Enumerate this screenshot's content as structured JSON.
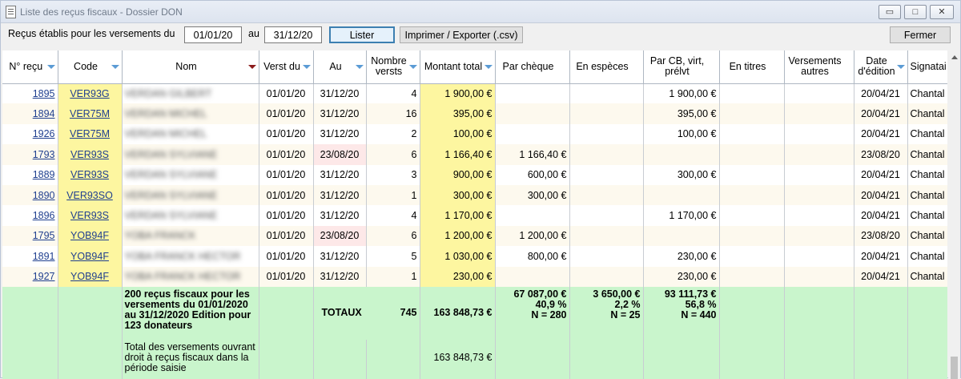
{
  "window": {
    "title": "Liste des reçus fiscaux - Dossier DON",
    "min_glyph": "▭",
    "max_glyph": "□",
    "close_glyph": "✕"
  },
  "toolbar": {
    "label_range": "Reçus établis pour les versements du",
    "date_from": "01/01/20",
    "label_to": "au",
    "date_to": "31/12/20",
    "lister": "Lister",
    "export": "Imprimer / Exporter (.csv)",
    "fermer": "Fermer"
  },
  "columns": {
    "num": "N° reçu",
    "code": "Code",
    "nom": "Nom",
    "verst_du": "Verst du",
    "au": "Au",
    "nb": "Nombre versts",
    "montant": "Montant total",
    "cheque": "Par chèque",
    "especes": "En espèces",
    "cb": "Par CB, virt, prélvt",
    "titres": "En titres",
    "autres": "Versements autres",
    "date_edition": "Date d'édition",
    "signataire": "Signatai"
  },
  "rows": [
    {
      "num": "1895",
      "code": "VER93G",
      "nom": "VERDAN GILBERT",
      "du": "01/01/20",
      "au": "31/12/20",
      "nb": "4",
      "montant": "1 900,00 €",
      "cheque": "",
      "especes": "",
      "cb": "1 900,00 €",
      "titres": "",
      "autres": "",
      "date": "20/04/21",
      "sig": "Chantal"
    },
    {
      "num": "1894",
      "code": "VER75M",
      "nom": "VERDAN MICHEL",
      "du": "01/01/20",
      "au": "31/12/20",
      "nb": "16",
      "montant": "395,00 €",
      "cheque": "",
      "especes": "",
      "cb": "395,00 €",
      "titres": "",
      "autres": "",
      "date": "20/04/21",
      "sig": "Chantal"
    },
    {
      "num": "1926",
      "code": "VER75M",
      "nom": "VERDAN MICHEL",
      "du": "01/01/20",
      "au": "31/12/20",
      "nb": "2",
      "montant": "100,00 €",
      "cheque": "",
      "especes": "",
      "cb": "100,00 €",
      "titres": "",
      "autres": "",
      "date": "20/04/21",
      "sig": "Chantal"
    },
    {
      "num": "1793",
      "code": "VER93S",
      "nom": "VERDAN SYLVIANE",
      "du": "01/01/20",
      "au": "23/08/20",
      "nb": "6",
      "montant": "1 166,40 €",
      "cheque": "1 166,40 €",
      "especes": "",
      "cb": "",
      "titres": "",
      "autres": "",
      "date": "23/08/20",
      "sig": "Chantal"
    },
    {
      "num": "1889",
      "code": "VER93S",
      "nom": "VERDAN SYLVIANE",
      "du": "01/01/20",
      "au": "31/12/20",
      "nb": "3",
      "montant": "900,00 €",
      "cheque": "600,00 €",
      "especes": "",
      "cb": "300,00 €",
      "titres": "",
      "autres": "",
      "date": "20/04/21",
      "sig": "Chantal"
    },
    {
      "num": "1890",
      "code": "VER93SO",
      "nom": "VERDAN SYLVIANE",
      "du": "01/01/20",
      "au": "31/12/20",
      "nb": "1",
      "montant": "300,00 €",
      "cheque": "300,00 €",
      "especes": "",
      "cb": "",
      "titres": "",
      "autres": "",
      "date": "20/04/21",
      "sig": "Chantal"
    },
    {
      "num": "1896",
      "code": "VER93S",
      "nom": "VERDAN SYLVIANE",
      "du": "01/01/20",
      "au": "31/12/20",
      "nb": "4",
      "montant": "1 170,00 €",
      "cheque": "",
      "especes": "",
      "cb": "1 170,00 €",
      "titres": "",
      "autres": "",
      "date": "20/04/21",
      "sig": "Chantal"
    },
    {
      "num": "1795",
      "code": "YOB94F",
      "nom": "YOBA FRANCK",
      "du": "01/01/20",
      "au": "23/08/20",
      "nb": "6",
      "montant": "1 200,00 €",
      "cheque": "1 200,00 €",
      "especes": "",
      "cb": "",
      "titres": "",
      "autres": "",
      "date": "23/08/20",
      "sig": "Chantal"
    },
    {
      "num": "1891",
      "code": "YOB94F",
      "nom": "YOBA FRANCK HECTOR",
      "du": "01/01/20",
      "au": "31/12/20",
      "nb": "5",
      "montant": "1 030,00 €",
      "cheque": "800,00 €",
      "especes": "",
      "cb": "230,00 €",
      "titres": "",
      "autres": "",
      "date": "20/04/21",
      "sig": "Chantal"
    },
    {
      "num": "1927",
      "code": "YOB94F",
      "nom": "YOBA FRANCK HECTOR",
      "du": "01/01/20",
      "au": "31/12/20",
      "nb": "1",
      "montant": "230,00 €",
      "cheque": "",
      "especes": "",
      "cb": "230,00 €",
      "titres": "",
      "autres": "",
      "date": "20/04/21",
      "sig": "Chantal"
    }
  ],
  "totals": {
    "summary": "200 reçus fiscaux pour les versements du 01/01/2020 au 31/12/2020 Edition pour 123 donateurs",
    "label": "TOTAUX",
    "nb": "745",
    "montant": "163 848,73 €",
    "cheque": {
      "amount": "67 087,00 €",
      "pct": "40,9 %",
      "n": "N = 280"
    },
    "especes": {
      "amount": "3 650,00 €",
      "pct": "2,2 %",
      "n": "N = 25"
    },
    "cb": {
      "amount": "93 111,73 €",
      "pct": "56,8 %",
      "n": "N = 440"
    },
    "ouvrant_label": "Total des versements ouvrant droit à reçus fiscaux dans la période saisie",
    "ouvrant_montant": "163 848,73 €"
  },
  "colors": {
    "yellow": "#fdf6a0",
    "green": "#c9f5cc",
    "pink": "#fde8e8",
    "sort": "#5b9bd5"
  }
}
